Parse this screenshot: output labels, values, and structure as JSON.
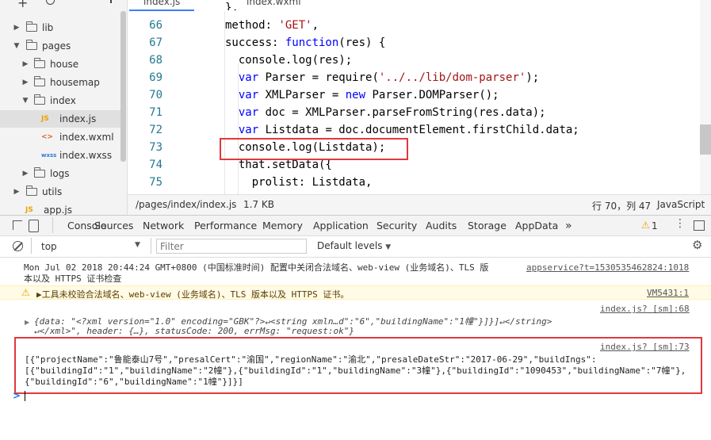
{
  "file_tree": {
    "items": [
      {
        "label": "lib",
        "type": "folder",
        "expanded": false
      },
      {
        "label": "pages",
        "type": "folder",
        "expanded": true
      },
      {
        "label": "house",
        "type": "folder",
        "expanded": false
      },
      {
        "label": "housemap",
        "type": "folder",
        "expanded": false
      },
      {
        "label": "index",
        "type": "folder",
        "expanded": true
      },
      {
        "label": "index.js",
        "type": "file",
        "tag": "JS"
      },
      {
        "label": "index.wxml",
        "type": "file",
        "tag": "<>"
      },
      {
        "label": "index.wxss",
        "type": "file",
        "tag": "wxss"
      },
      {
        "label": "logs",
        "type": "folder",
        "expanded": false
      },
      {
        "label": "utils",
        "type": "folder",
        "expanded": false
      },
      {
        "label": "app.js",
        "type": "file",
        "tag": "JS"
      }
    ]
  },
  "editor": {
    "tabs": [
      "index.js",
      "index.wxml"
    ],
    "lines": [
      {
        "num": "66",
        "text": "method: 'GET',"
      },
      {
        "num": "67",
        "text": "success: function(res) {"
      },
      {
        "num": "68",
        "text": "  console.log(res);"
      },
      {
        "num": "69",
        "text": "  var Parser = require('../../lib/dom-parser');"
      },
      {
        "num": "70",
        "text": "  var XMLParser = new Parser.DOMParser();"
      },
      {
        "num": "71",
        "text": "  var doc = XMLParser.parseFromString(res.data);"
      },
      {
        "num": "72",
        "text": "  var Listdata = doc.documentElement.firstChild.data;"
      },
      {
        "num": "73",
        "text": "  console.log(Listdata);"
      },
      {
        "num": "74",
        "text": "  that.setData({"
      },
      {
        "num": "75",
        "text": "    prolist: Listdata,"
      }
    ],
    "top_fragment": "},"
  },
  "status_bar": {
    "path": "/pages/index/index.js",
    "size": "1.7 KB",
    "position": "行 70，列 47",
    "language": "JavaScript"
  },
  "devtools": {
    "tabs": [
      "Console",
      "Sources",
      "Network",
      "Performance",
      "Memory",
      "Application",
      "Security",
      "Audits",
      "Storage",
      "AppData"
    ],
    "more": "»",
    "warning_count": "1",
    "context": "top",
    "filter_placeholder": "Filter",
    "levels": "Default levels"
  },
  "console": {
    "msg1": {
      "line1": "Mon Jul 02 2018 20:44:24 GMT+0800 (中国标准时间) 配置中关闭合法域名、web-view (业务域名)、TLS 版",
      "line2": "本以及 HTTPS 证书检查",
      "source": "appservice?t=1530535462824:1018"
    },
    "msg2": {
      "text": "▶工具未校验合法域名、web-view (业务域名)、TLS 版本以及 HTTPS 证书。",
      "source": "VM5431:1"
    },
    "msg3": {
      "source": "index.js? [sm]:68",
      "line1": "{data: \"<?xml version=\"1.0\" encoding=\"GBK\"?>↵<string xmln…d\":\"6\",\"buildingName\":\"1幢\"}]}]↵</string>",
      "line2": "↵</xml>\", header: {…}, statusCode: 200, errMsg: \"request:ok\"}"
    },
    "msg4": {
      "source": "index.js? [sm]:73",
      "line1": "[{\"projectName\":\"鲁能泰山7号\",\"presalCert\":\"渝国\",\"regionName\":\"渝北\",\"presaleDateStr\":\"2017-06-29\",\"buildIngs\":",
      "line2": "[{\"buildingId\":\"1\",\"buildingName\":\"2幢\"},{\"buildingId\":\"1\",\"buildingName\":\"3幢\"},{\"buildingId\":\"1090453\",\"buildingName\":\"7幢\"},",
      "line3": "{\"buildingId\":\"6\",\"buildingName\":\"1幢\"}]}]"
    },
    "prompt": ">"
  }
}
